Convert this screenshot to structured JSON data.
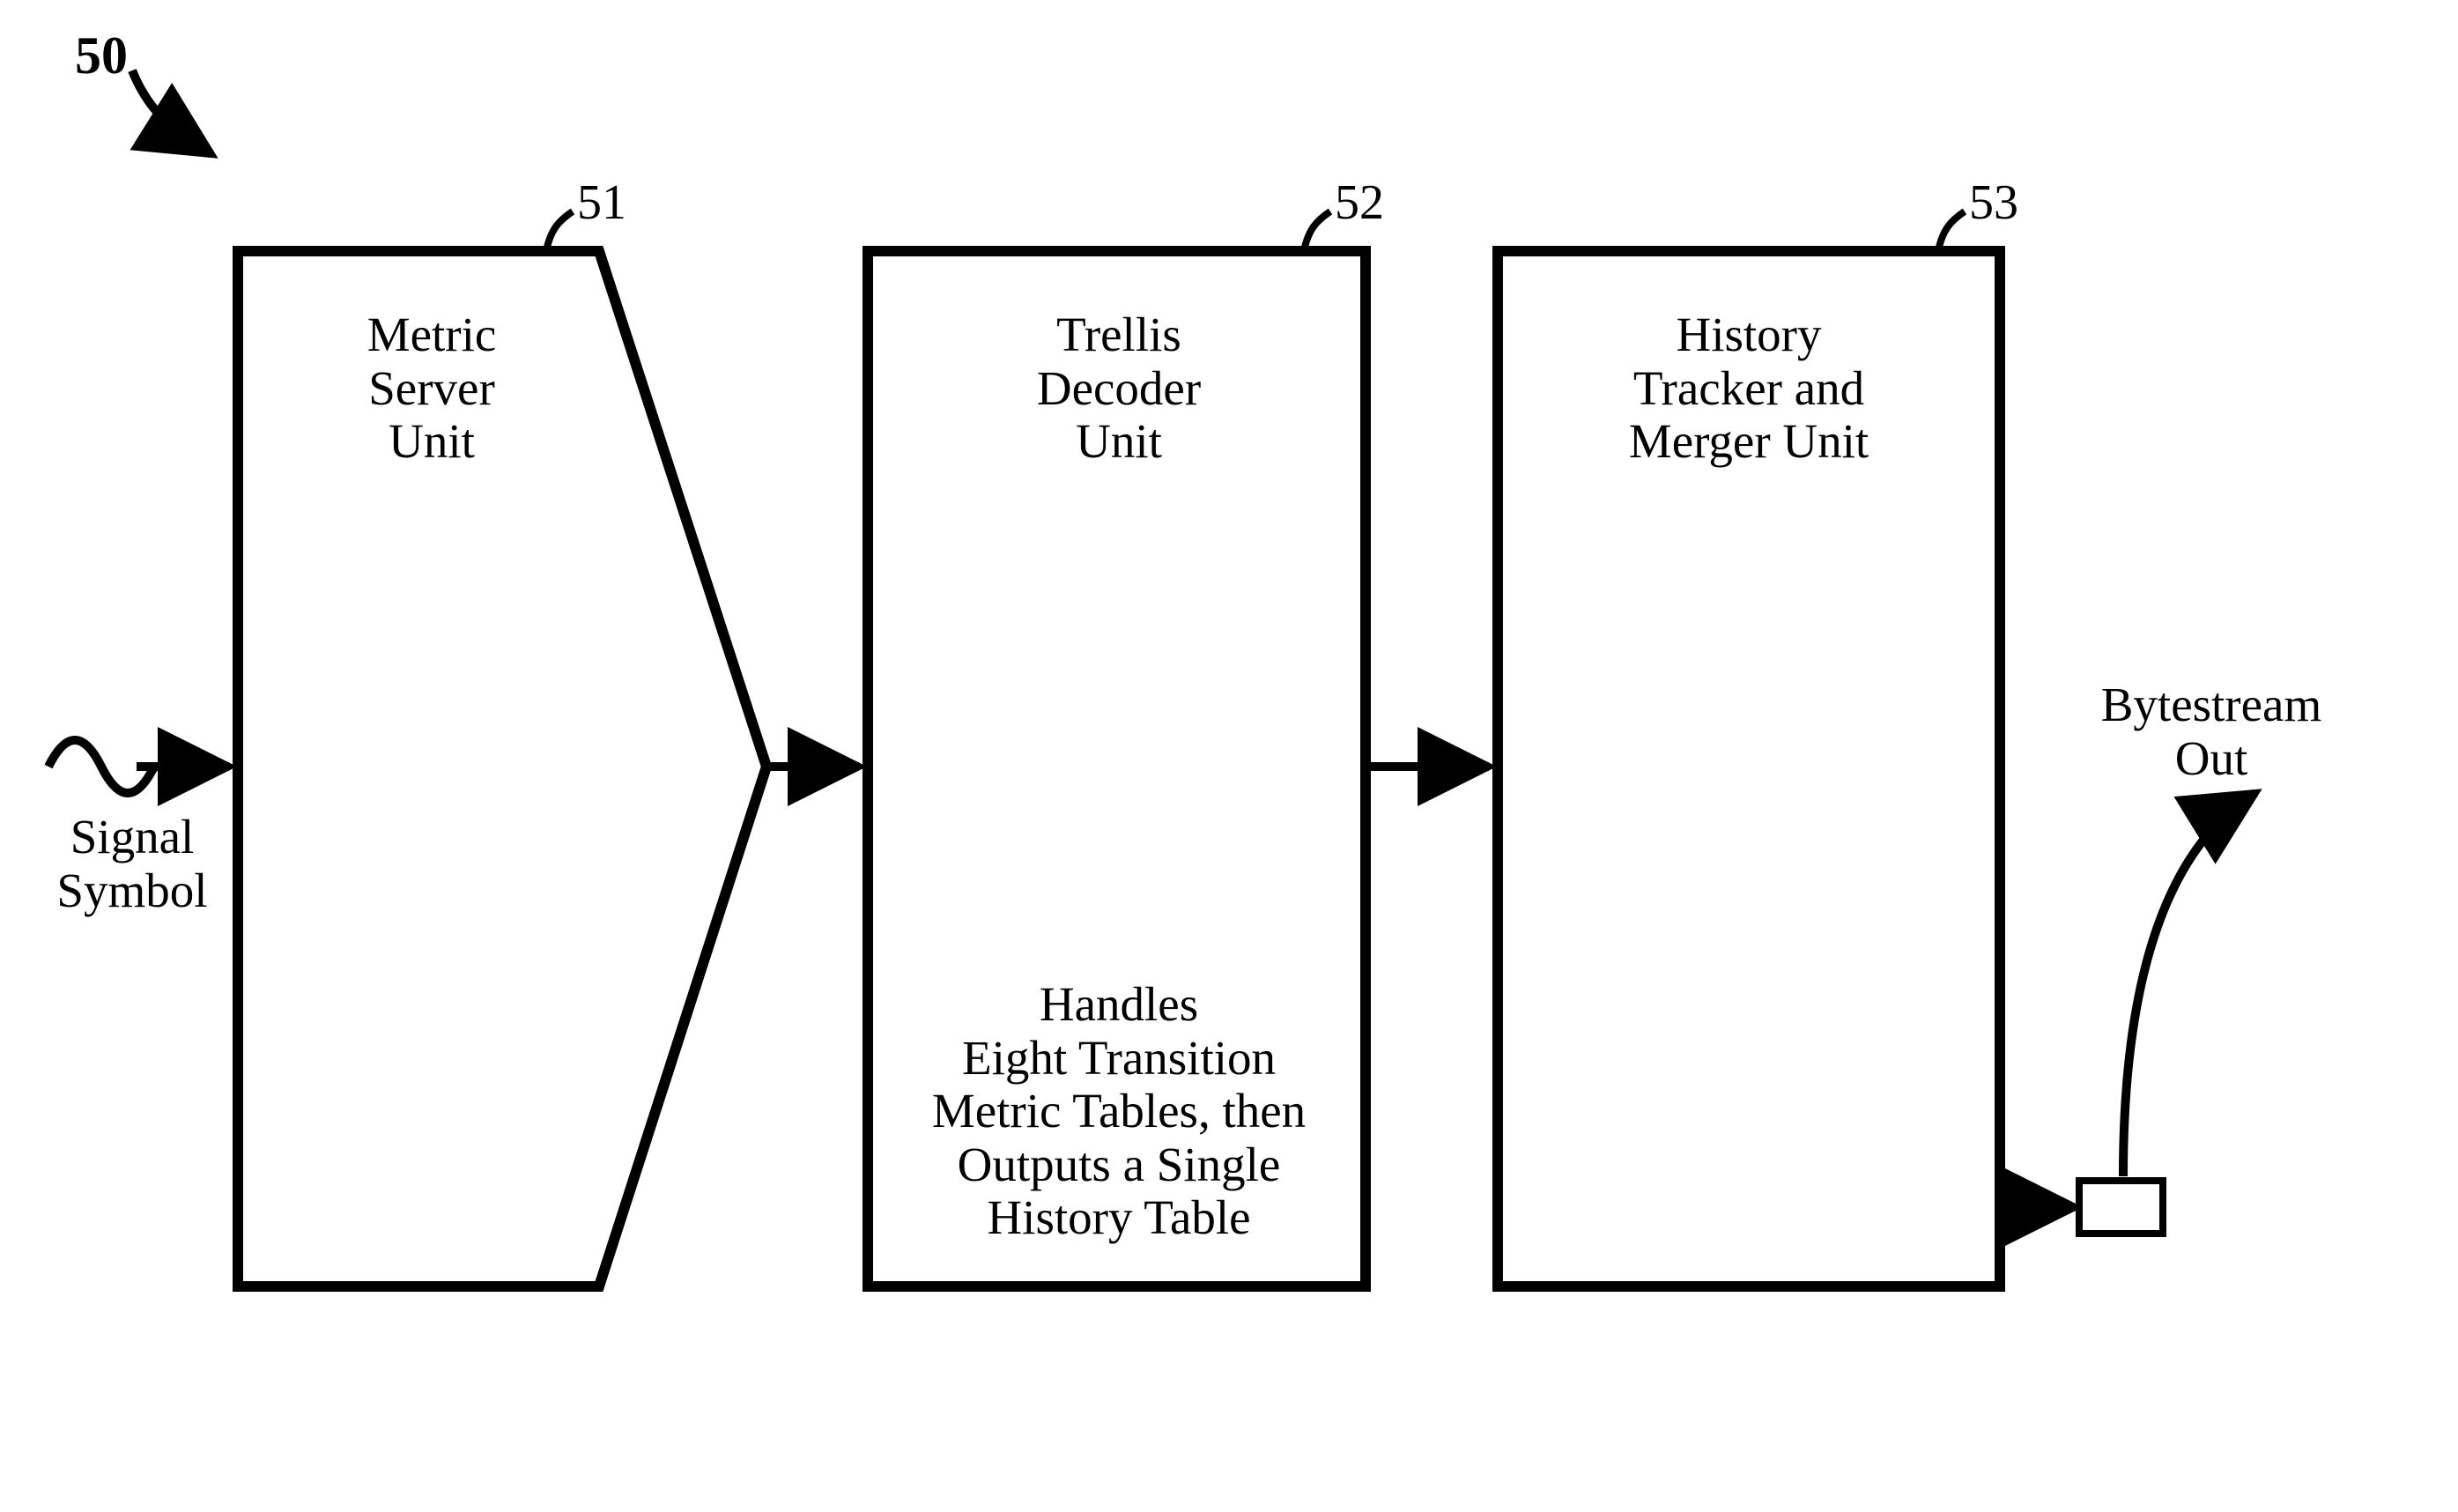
{
  "figure_number_label": "50",
  "input_label": "Signal\nSymbol",
  "output_label": "Bytestream\nOut",
  "blocks": {
    "metric_server": {
      "ref": "51",
      "title": "Metric\nServer\nUnit"
    },
    "trellis_decoder": {
      "ref": "52",
      "title": "Trellis\nDecoder\nUnit",
      "body": "Handles\nEight Transition\nMetric Tables, then\nOutputs a Single\nHistory Table"
    },
    "history_tracker": {
      "ref": "53",
      "title": "History\nTracker and\nMerger Unit"
    }
  }
}
